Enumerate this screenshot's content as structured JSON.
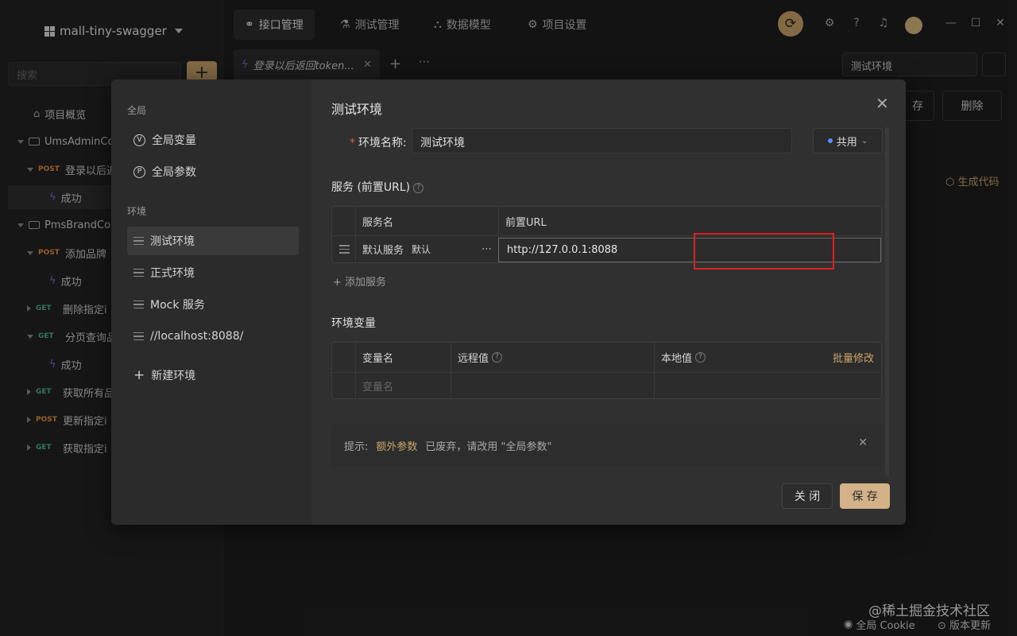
{
  "sidebar": {
    "project": "mall-tiny-swagger",
    "search_placeholder": "搜索",
    "items": [
      {
        "label": "项目概览"
      },
      {
        "label": "UmsAdminCo"
      },
      {
        "method": "POST",
        "label": "登录以后返"
      },
      {
        "label": "成功"
      },
      {
        "label": "PmsBrandCo"
      },
      {
        "method": "POST",
        "label": "添加品牌"
      },
      {
        "label": "成功"
      },
      {
        "method": "GET",
        "label": "删除指定i"
      },
      {
        "method": "GET",
        "label": "分页查询品"
      },
      {
        "label": "成功"
      },
      {
        "method": "GET",
        "label": "获取所有品"
      },
      {
        "method": "POST",
        "label": "更新指定i"
      },
      {
        "method": "GET",
        "label": "获取指定i"
      }
    ]
  },
  "topnav": {
    "tabs": [
      {
        "icon": "link-icon",
        "label": "接口管理"
      },
      {
        "icon": "flask-icon",
        "label": "测试管理"
      },
      {
        "icon": "model-icon",
        "label": "数据模型"
      },
      {
        "icon": "gear-icon",
        "label": "项目设置"
      }
    ]
  },
  "tabbar": {
    "doc_tab": "登录以后返回token...",
    "env_select": "测试环境"
  },
  "background": {
    "save_partial": "存",
    "delete": "删除",
    "gen_code": "生成代码"
  },
  "modal": {
    "left": {
      "global_label": "全局",
      "global_vars": "全局变量",
      "global_params": "全局参数",
      "env_label": "环境",
      "envs": [
        "测试环境",
        "正式环境",
        "Mock 服务",
        "//localhost:8088/"
      ],
      "new_env": "新建环境"
    },
    "title": "测试环境",
    "name_label": "环境名称:",
    "name_value": "测试环境",
    "shared": "共用",
    "service_title": "服务 (前置URL)",
    "service_cols": [
      "服务名",
      "前置URL"
    ],
    "service_row": {
      "name": "默认服务",
      "tag": "默认",
      "url": "http://127.0.0.1:8088"
    },
    "add_service": "添加服务",
    "vars_title": "环境变量",
    "vars_cols": [
      "变量名",
      "远程值",
      "本地值"
    ],
    "batch_edit": "批量修改",
    "var_placeholder": "变量名",
    "tip": {
      "prefix": "提示:",
      "highlight": "额外参数",
      "text": "已废弃，请改用 \"全局参数\""
    },
    "close_btn": "关 闭",
    "save_btn": "保 存"
  },
  "footer": {
    "cookie": "全局 Cookie",
    "update": "版本更新",
    "watermark": "@稀土掘金技术社区"
  },
  "colors": {
    "accent": "#c9a46a",
    "highlight_box": "#e02020"
  }
}
